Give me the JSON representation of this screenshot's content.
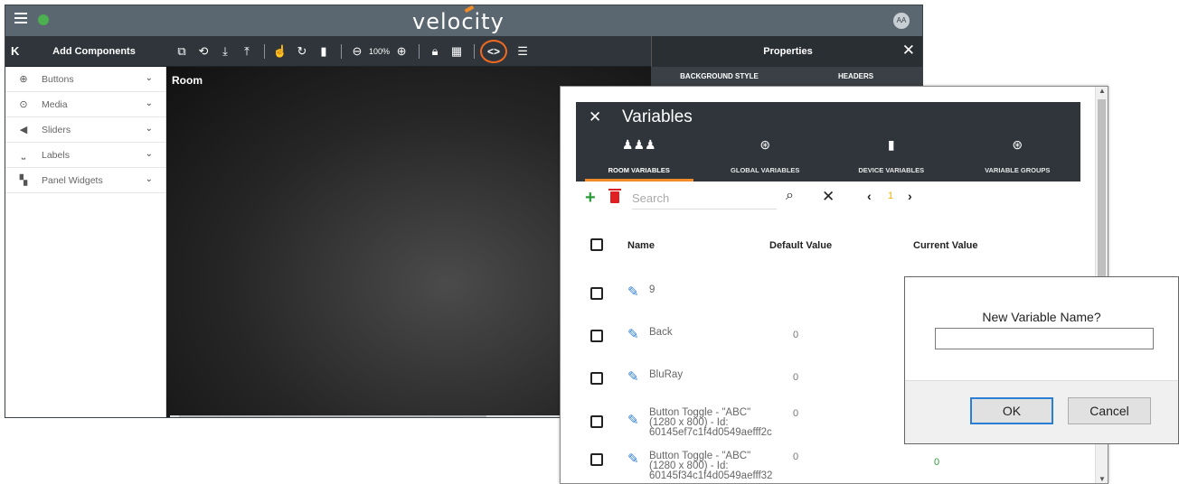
{
  "app": {
    "brand": "velocity",
    "avatar": "AA"
  },
  "toolbar": {
    "collapse": "K",
    "add_components": "Add Components",
    "zoom": "100%",
    "properties_title": "Properties"
  },
  "sidebar": {
    "items": [
      {
        "label": "Buttons",
        "icon": "plus-circle-icon"
      },
      {
        "label": "Media",
        "icon": "play-circle-icon"
      },
      {
        "label": "Sliders",
        "icon": "volume-icon"
      },
      {
        "label": "Labels",
        "icon": "label-icon"
      },
      {
        "label": "Panel Widgets",
        "icon": "widgets-icon"
      }
    ]
  },
  "canvas": {
    "room_label": "Room"
  },
  "properties": {
    "tabs": [
      "BACKGROUND STYLE",
      "HEADERS"
    ]
  },
  "variables": {
    "title": "Variables",
    "tabs": [
      {
        "label": "ROOM VARIABLES",
        "active": true
      },
      {
        "label": "GLOBAL VARIABLES",
        "active": false
      },
      {
        "label": "DEVICE VARIABLES",
        "active": false
      },
      {
        "label": "VARIABLE GROUPS",
        "active": false
      }
    ],
    "search_placeholder": "Search",
    "page": "1",
    "columns": {
      "name": "Name",
      "default": "Default Value",
      "current": "Current Value"
    },
    "rows": [
      {
        "name": "9",
        "default": "",
        "current": ""
      },
      {
        "name": "Back",
        "default": "0",
        "current": ""
      },
      {
        "name": "BluRay",
        "default": "0",
        "current": ""
      },
      {
        "name": "Button Toggle - \"ABC\" (1280 x 800) - Id: 60145ef7c1f4d0549aefff2c",
        "default": "0",
        "current": ""
      },
      {
        "name": "Button Toggle - \"ABC\" (1280 x 800) - Id: 60145f34c1f4d0549aefff32",
        "default": "0",
        "current": "0"
      }
    ]
  },
  "prompt": {
    "question": "New Variable Name?",
    "value": "",
    "ok": "OK",
    "cancel": "Cancel"
  },
  "colors": {
    "accent": "#f28c28",
    "highlight": "#f26a21",
    "topbar": "#5b6770",
    "dark": "#2f353b",
    "add": "#2e9b3a",
    "delete": "#e02020",
    "edit": "#2f7fd6"
  }
}
